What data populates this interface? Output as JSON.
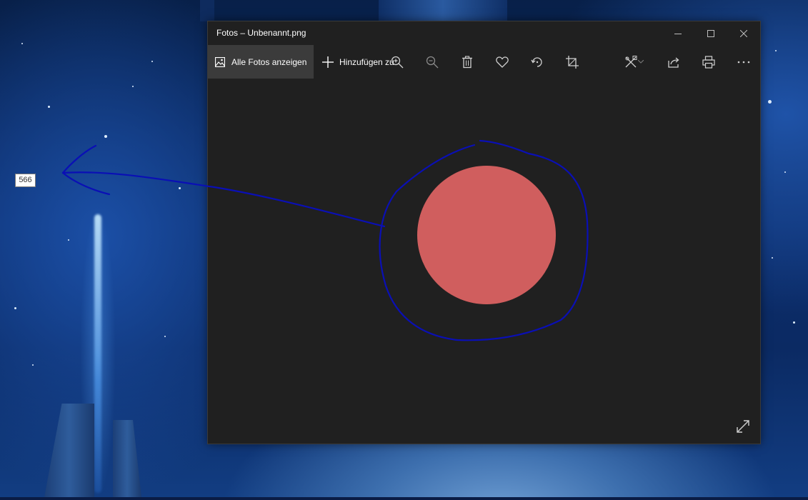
{
  "window": {
    "title": "Fotos – Unbenannt.png"
  },
  "toolbar": {
    "all_photos_label": "Alle Fotos anzeigen",
    "add_label": "Hinzufügen zu",
    "icons": [
      "zoom-in-icon",
      "zoom-out-icon",
      "delete-icon",
      "favorite-icon",
      "rotate-icon",
      "crop-icon",
      "edit-icon",
      "share-icon",
      "print-icon",
      "more-icon"
    ]
  },
  "tooltip": {
    "value": "566"
  },
  "photo": {
    "circle_color": "#d05e5e"
  },
  "annotation": {
    "color": "#0a0fb5"
  },
  "colors": {
    "window_bg": "#202020",
    "toolbar_active": "#3b3b3b",
    "icon": "#d0d0d0"
  }
}
